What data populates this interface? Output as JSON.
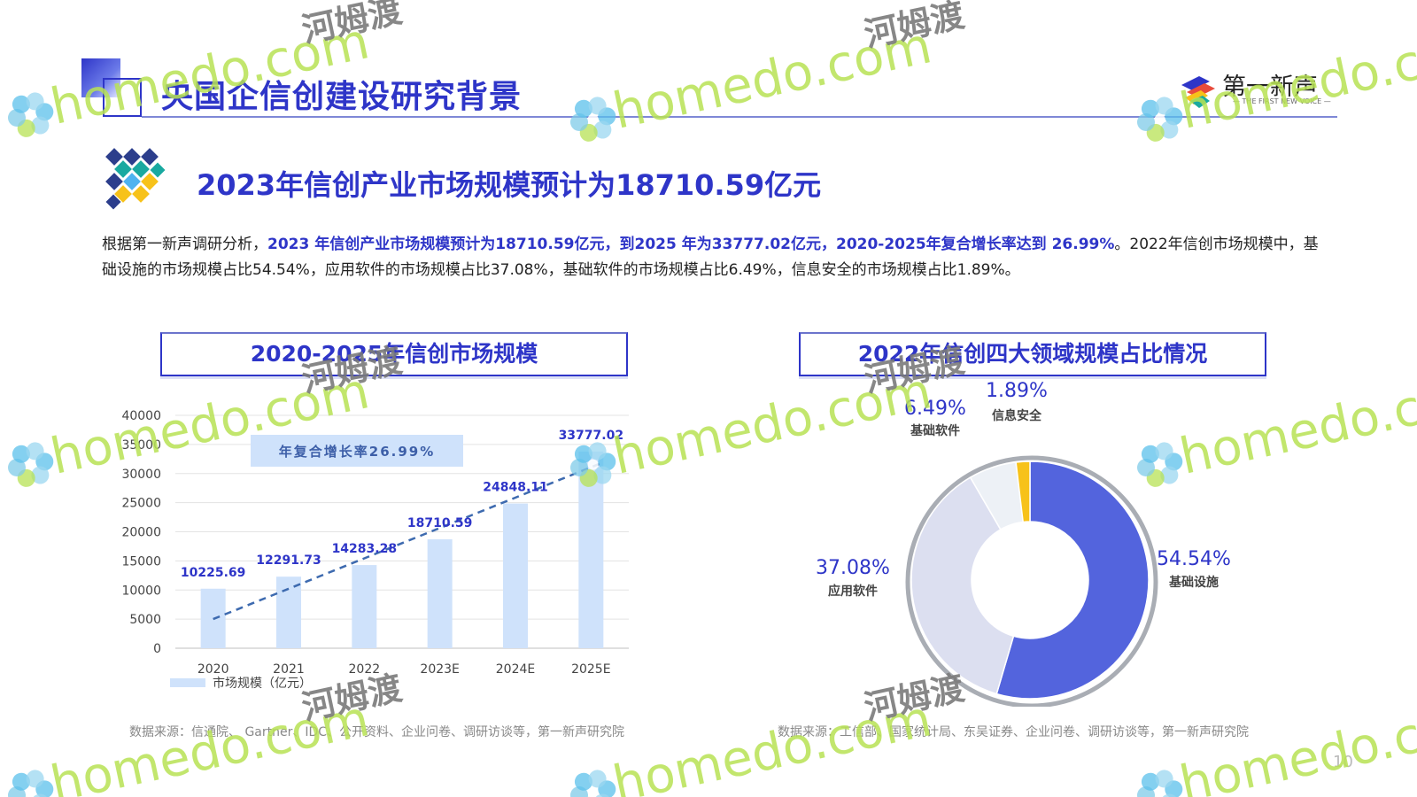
{
  "header": {
    "title": "央国企信创建设研究背景",
    "logo_name": "第一新声",
    "logo_sub": "— THE FIRST NEW VOICE —"
  },
  "subtitle": "2023年信创产业市场规模预计为18710.59亿元",
  "summary": {
    "p1": "根据第一新声调研分析，",
    "h1": "2023 年信创产业市场规模预计为18710.59亿元，到2025 年为33777.02亿元，",
    "h2": "2020-2025年复合增长率达到 26.99%",
    "p2": "。2022年信创市场规模中，基础设施的市场规模占比54.54%，应用软件的市场规模占比37.08%，基础软件的市场规模占比6.49%，信息安全的市场规模占比1.89%。"
  },
  "panels": {
    "left_title": "2020-2025年信创市场规模",
    "right_title": "2022年信创四大领域规模占比情况"
  },
  "sources": {
    "left": "数据来源：信通院、 Gartner、IDC、公开资料、企业问卷、调研访谈等，第一新声研究院",
    "right": "数据来源：工信部、国家统计局、东吴证券、企业问卷、调研访谈等，第一新声研究院"
  },
  "page_number": "10",
  "watermark": {
    "text": "homedo.com",
    "cn": "河姆渡"
  },
  "colors": {
    "brand": "#2e35c8",
    "bar": "#cfe2fb",
    "trend": "#3d6aaf",
    "infra": "#5364dd",
    "app": "#dcdff0",
    "base_sw": "#edf1f6",
    "security": "#f7c21a"
  },
  "chart_data": [
    {
      "type": "bar",
      "categories": [
        "2020",
        "2021",
        "2022",
        "2023E",
        "2024E",
        "2025E"
      ],
      "series": [
        {
          "name": "市场规模（亿元）",
          "values": [
            10225.69,
            12291.73,
            14283.28,
            18710.59,
            24848.11,
            33777.02
          ]
        }
      ],
      "data_labels": [
        "10225.69",
        "12291.73",
        "14283.28",
        "18710.59",
        "24848.11",
        "33777.02"
      ],
      "yticks": [
        "0",
        "5000",
        "10000",
        "15000",
        "20000",
        "25000",
        "30000",
        "35000",
        "40000"
      ],
      "ylim": [
        0,
        40000
      ],
      "trendline": true,
      "annotation": "年复合增长率26.99%",
      "legend": "bottom-left",
      "grid": true
    },
    {
      "type": "pie",
      "donut": true,
      "slices": [
        {
          "label": "基础设施",
          "value": 54.54,
          "text": "54.54%"
        },
        {
          "label": "应用软件",
          "value": 37.08,
          "text": "37.08%"
        },
        {
          "label": "基础软件",
          "value": 6.49,
          "text": "6.49%"
        },
        {
          "label": "信息安全",
          "value": 1.89,
          "text": "1.89%"
        }
      ]
    }
  ]
}
